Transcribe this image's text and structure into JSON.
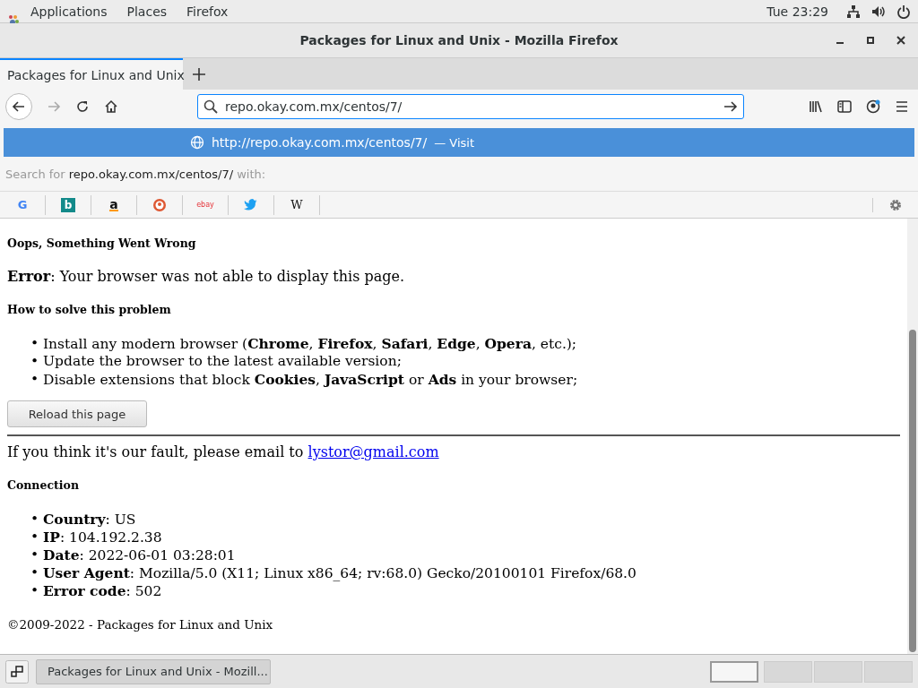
{
  "top_bar": {
    "menus": [
      "Applications",
      "Places",
      "Firefox"
    ],
    "clock": "Tue 23:29"
  },
  "window": {
    "title": "Packages for Linux and Unix - Mozilla Firefox"
  },
  "tabs": [
    {
      "label": "Packages for Linux and Unix",
      "selected": true
    }
  ],
  "address_bar": {
    "value": "repo.okay.com.mx/centos/7/"
  },
  "suggestion": {
    "url": "http://**repo.okay.com.mx/centos/7/**",
    "action": "— Visit",
    "selected": true
  },
  "search_row": {
    "text": "Search for **repo.okay.com.mx/centos/7/** with:"
  },
  "search_engines": [
    {
      "kind": "google",
      "glyph": "G"
    },
    {
      "kind": "bing",
      "glyph": "b"
    },
    {
      "kind": "amazon",
      "glyph": "a"
    },
    {
      "kind": "duckduckgo"
    },
    {
      "kind": "ebay",
      "glyph": "ebay"
    },
    {
      "kind": "twitter"
    },
    {
      "kind": "wikipedia",
      "glyph": "W"
    }
  ],
  "page": {
    "heading": "Oops, Something Went Wrong",
    "error": "**Error**: Your browser was not able to display this page.",
    "solve_heading": "How to solve this problem",
    "solve_items": [
      {
        "marker": "•",
        "text": "Install any modern browser (**Chrome**, **Firefox**, **Safari**, **Edge**, **Opera**, etc.);"
      },
      {
        "marker": "•",
        "text": "Update the browser to the latest available version;"
      },
      {
        "marker": "•",
        "text": "Disable extensions that block **Cookies**, **JavaScript** or **Ads** in your browser;"
      }
    ],
    "reload_button": "Reload this page",
    "fault_text": "If you think it's our fault, please email to",
    "fault_link": "lystor@gmail.com",
    "connection_heading": "Connection",
    "connection_items": [
      {
        "marker": "•",
        "text": "**Country**: US"
      },
      {
        "marker": "•",
        "text": "**IP**: 104.192.2.38"
      },
      {
        "marker": "•",
        "text": "**Date**: 2022-06-01 03:28:01"
      },
      {
        "marker": "•",
        "text": "**User Agent**: Mozilla/5.0 (X11; Linux x86_64; rv:68.0) Gecko/20100101 Firefox/68.0"
      },
      {
        "marker": "•",
        "text": "**Error code**: 502"
      }
    ],
    "footer": "©2009-2022 - Packages for Linux and Unix"
  },
  "taskbar": {
    "task": "Packages for Linux and Unix - Mozill...",
    "workspaces": [
      {
        "selected": true
      },
      {
        "selected": false
      },
      {
        "selected": false
      },
      {
        "selected": false
      }
    ]
  }
}
